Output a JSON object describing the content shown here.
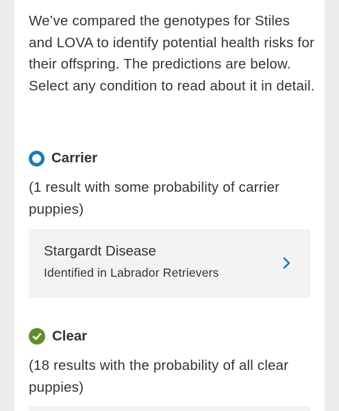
{
  "intro": {
    "text": "We’ve compared the genotypes for Stiles and LOVA to identify potential health risks for their offspring. The predictions are below. Select any condition to read about it in detail."
  },
  "carrier": {
    "label": "Carrier",
    "icon": "carrier-ring-icon",
    "summary": "(1 result with some probability of carrier puppies)",
    "items": [
      {
        "name": "Stargardt Disease",
        "subtitle": "Identified in Labrador Retrievers"
      }
    ]
  },
  "clear": {
    "label": "Clear",
    "icon": "check-circle-icon",
    "summary": "(18 results with the probability of all clear puppies)"
  },
  "colors": {
    "carrier_accent": "#1a7ab0",
    "clear_accent": "#5e8d2b",
    "item_background": "#f3f3f3",
    "page_background": "#ececec",
    "text": "#333333"
  }
}
